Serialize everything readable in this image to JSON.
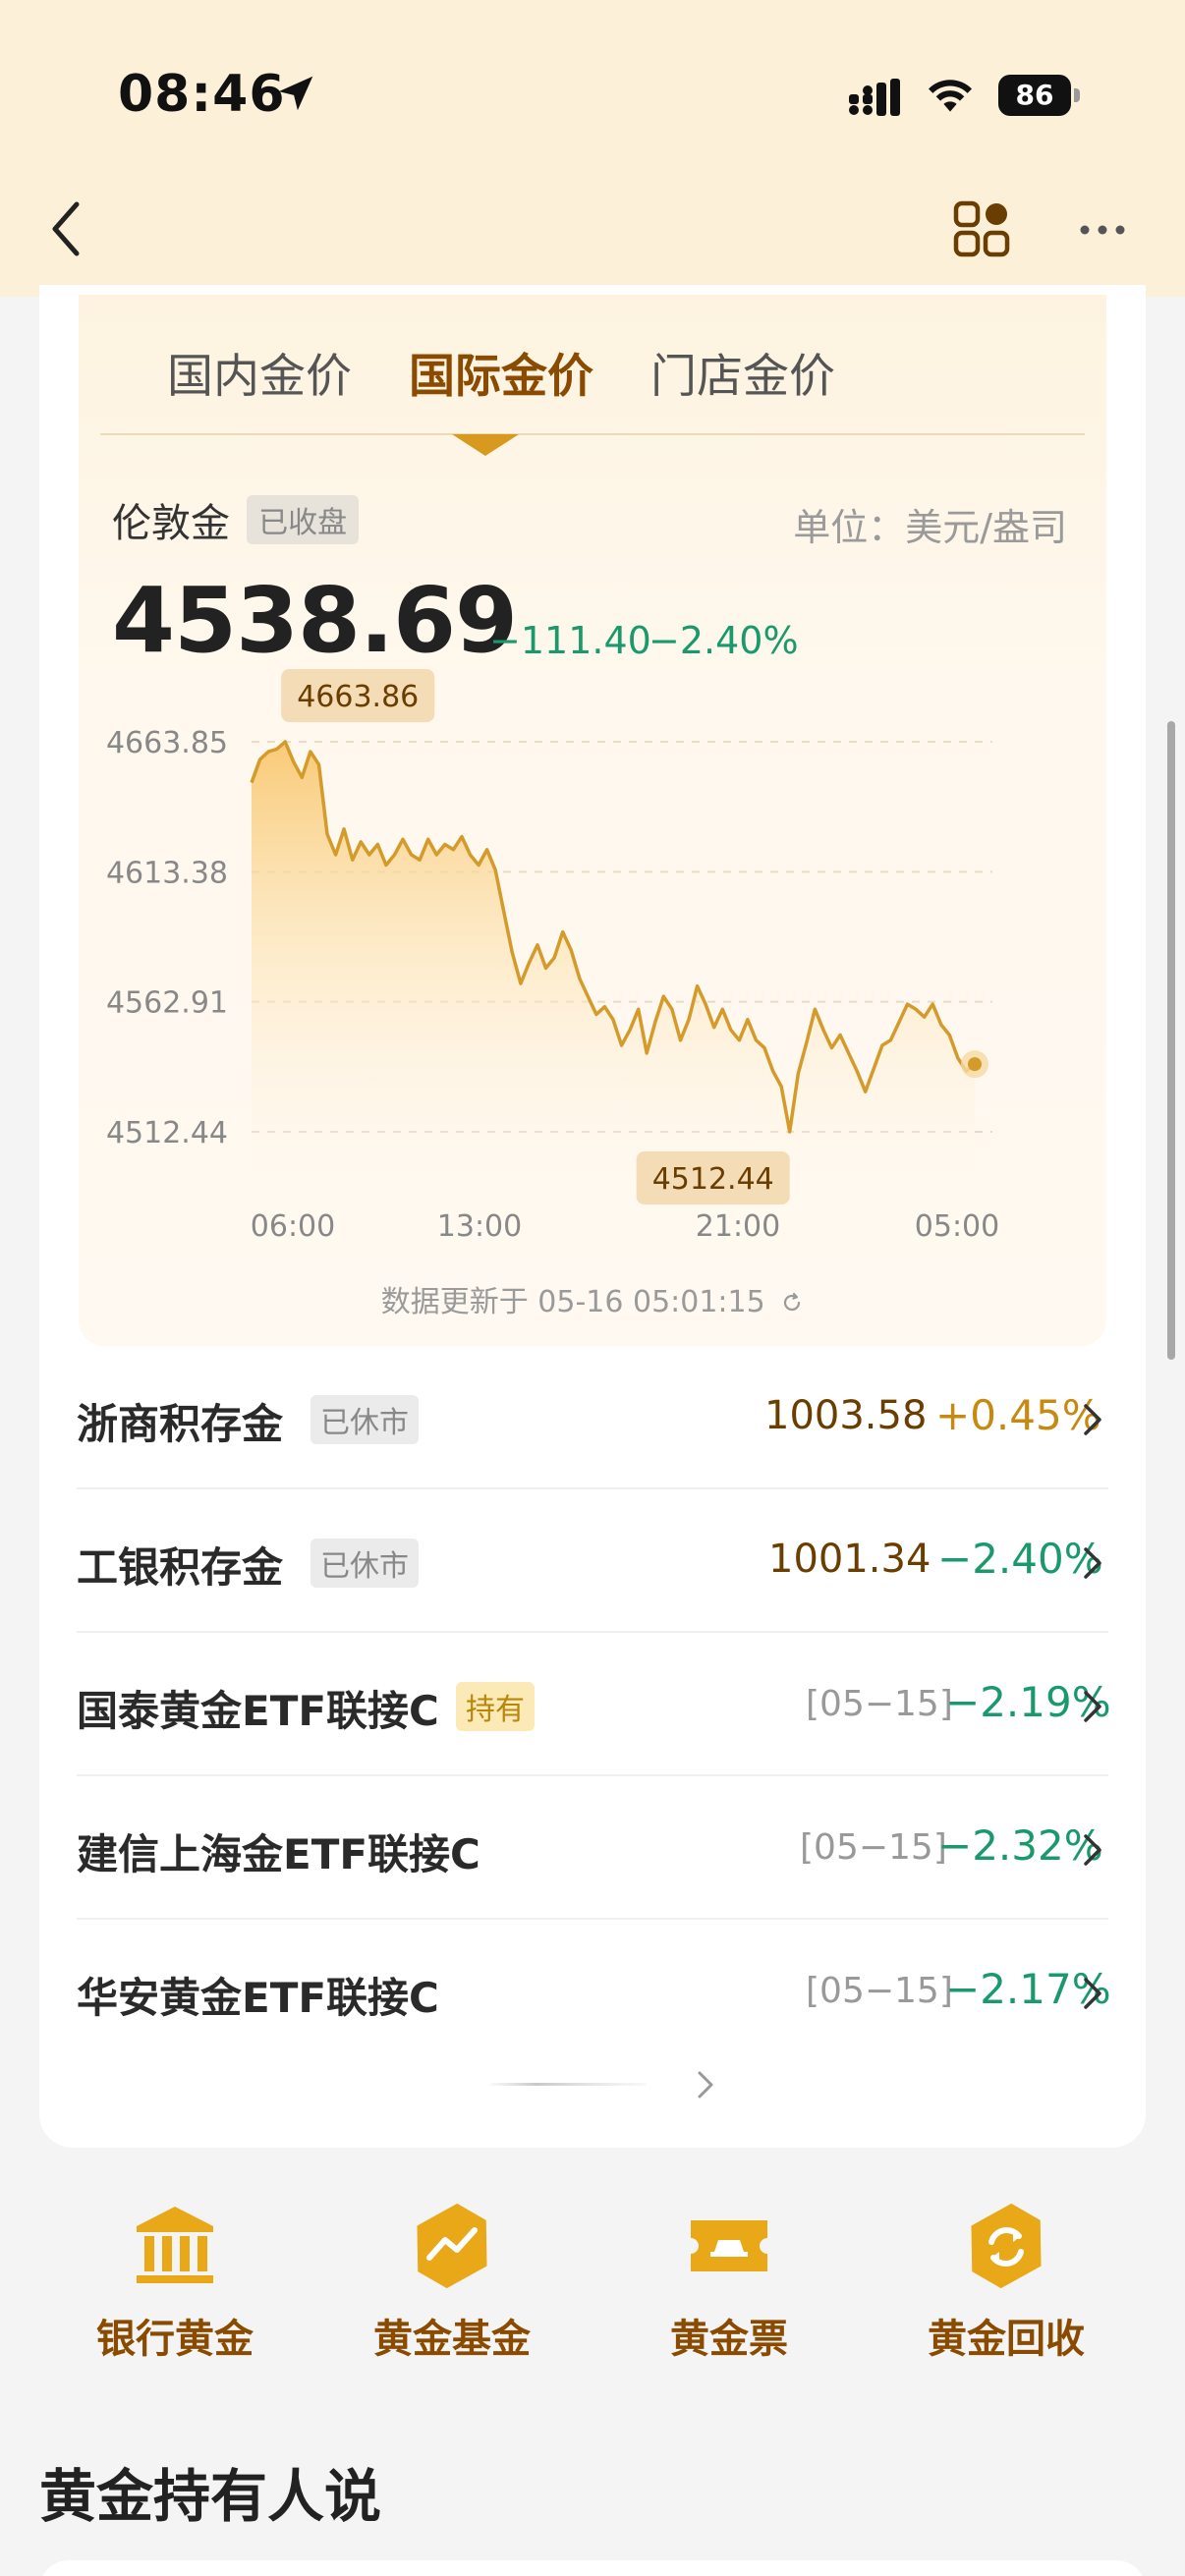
{
  "status_bar": {
    "time": "08:46",
    "battery": "86"
  },
  "tabs": [
    {
      "label": "国内金价",
      "active": false
    },
    {
      "label": "国际金价",
      "active": true
    },
    {
      "label": "门店金价",
      "active": false
    }
  ],
  "quote": {
    "name": "伦敦金",
    "status_badge": "已收盘",
    "unit": "单位：美元/盎司",
    "price": "4538.69",
    "change": "−111.40",
    "change_pct": "−2.40%",
    "high_label": "4663.86",
    "low_label": "4512.44",
    "updated": "数据更新于 05-16 05:01:15"
  },
  "chart_data": {
    "type": "line",
    "title": "",
    "ylim": [
      4500,
      4672
    ],
    "y_ticks": [
      "4663.85",
      "4613.38",
      "4562.91",
      "4512.44"
    ],
    "x_ticks": [
      "06:00",
      "13:00",
      "21:00",
      "05:00"
    ],
    "high": 4663.86,
    "low": 4512.44,
    "last": 4538.69,
    "series": [
      {
        "values": [
          4648,
          4657,
          4660,
          4661,
          4663.86,
          4656,
          4650,
          4660,
          4655,
          4628,
          4620,
          4630,
          4618,
          4625,
          4620,
          4624,
          4616,
          4620,
          4626,
          4620,
          4618,
          4626,
          4620,
          4624,
          4622,
          4627,
          4620,
          4616,
          4622,
          4614,
          4598,
          4582,
          4570,
          4578,
          4585,
          4576,
          4580,
          4590,
          4583,
          4572,
          4565,
          4558,
          4561,
          4556,
          4546,
          4552,
          4560,
          4543,
          4555,
          4565,
          4560,
          4548,
          4556,
          4569,
          4562,
          4553,
          4560,
          4552,
          4548,
          4556,
          4548,
          4545,
          4536,
          4530,
          4512.44,
          4535,
          4547,
          4560,
          4552,
          4545,
          4550,
          4543,
          4536,
          4528,
          4537,
          4546,
          4548,
          4555,
          4562,
          4560,
          4557,
          4562,
          4554,
          4550,
          4541,
          4536,
          4538.69
        ]
      }
    ]
  },
  "products": [
    {
      "name": "浙商积存金",
      "badge": "已休市",
      "badge_style": "grey",
      "value": "1003.58",
      "pct": "+0.45%",
      "dir": "pos"
    },
    {
      "name": "工银积存金",
      "badge": "已休市",
      "badge_style": "grey",
      "value": "1001.34",
      "pct": "−2.40%",
      "dir": "neg"
    },
    {
      "name": "国泰黄金ETF联接C",
      "badge": "持有",
      "badge_style": "gold",
      "date": "[05−15]",
      "pct": "−2.19%",
      "dir": "neg"
    },
    {
      "name": "建信上海金ETF联接C",
      "date": "[05−15]",
      "pct": "−2.32%",
      "dir": "neg"
    },
    {
      "name": "华安黄金ETF联接C",
      "date": "[05−15]",
      "pct": "−2.17%",
      "dir": "neg"
    }
  ],
  "shortcuts": [
    {
      "label": "银行黄金",
      "icon": "bank-icon"
    },
    {
      "label": "黄金基金",
      "icon": "fund-chart-icon"
    },
    {
      "label": "黄金票",
      "icon": "ticket-icon"
    },
    {
      "label": "黄金回收",
      "icon": "recycle-icon"
    }
  ],
  "section": {
    "title": "黄金持有人说"
  },
  "colors": {
    "accent": "#c78a11",
    "down": "#1a9a6c",
    "brand_brown": "#8a4b00",
    "header_bg": "#fdf0d8"
  }
}
